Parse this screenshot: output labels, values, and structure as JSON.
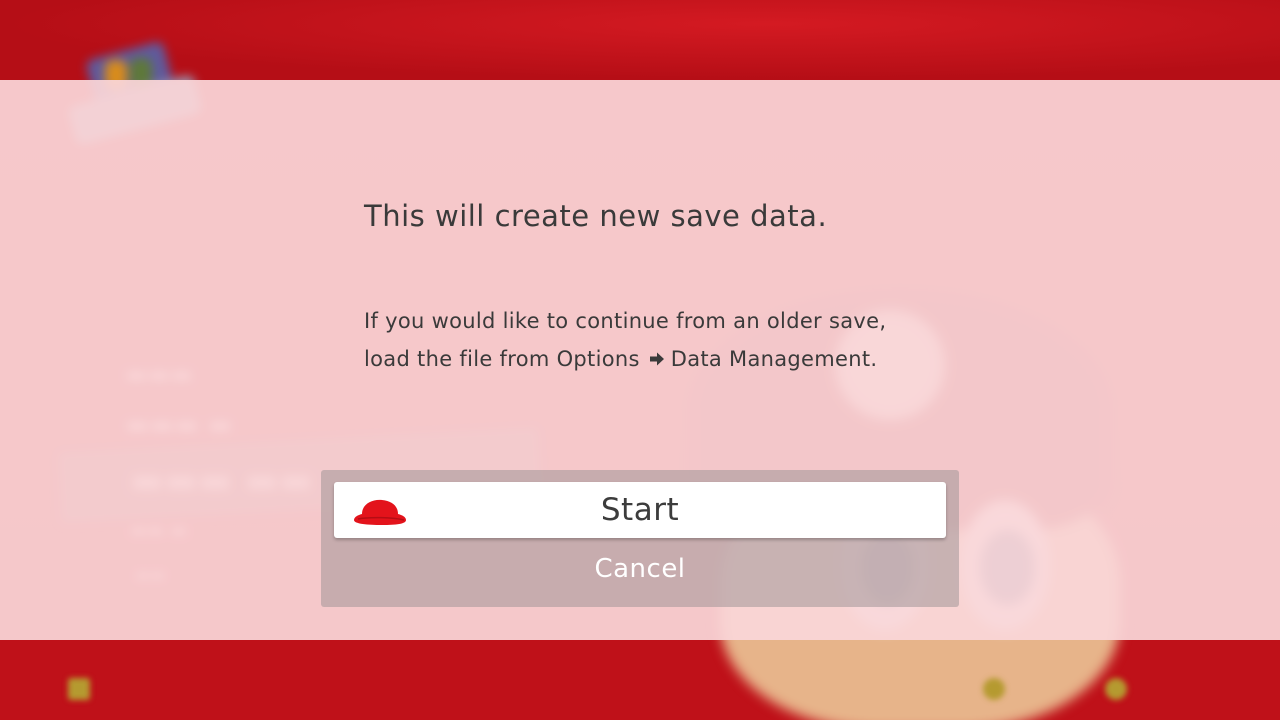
{
  "dialog": {
    "headline": "This will create new save data.",
    "body_line1": "If you would like to continue from an older save,",
    "body_line2_prefix": "load the file from Options",
    "body_line2_arrow_icon": "right-arrow-icon",
    "body_line2_suffix": "Data Management.",
    "cursor_icon": "mario-cap-icon"
  },
  "buttons": {
    "start_label": "Start",
    "cancel_label": "Cancel"
  },
  "colors": {
    "overlay": "#fad6d8",
    "background_red": "#c40f18",
    "cap_red": "#e3131b",
    "text_dark": "#3a3a3a"
  }
}
